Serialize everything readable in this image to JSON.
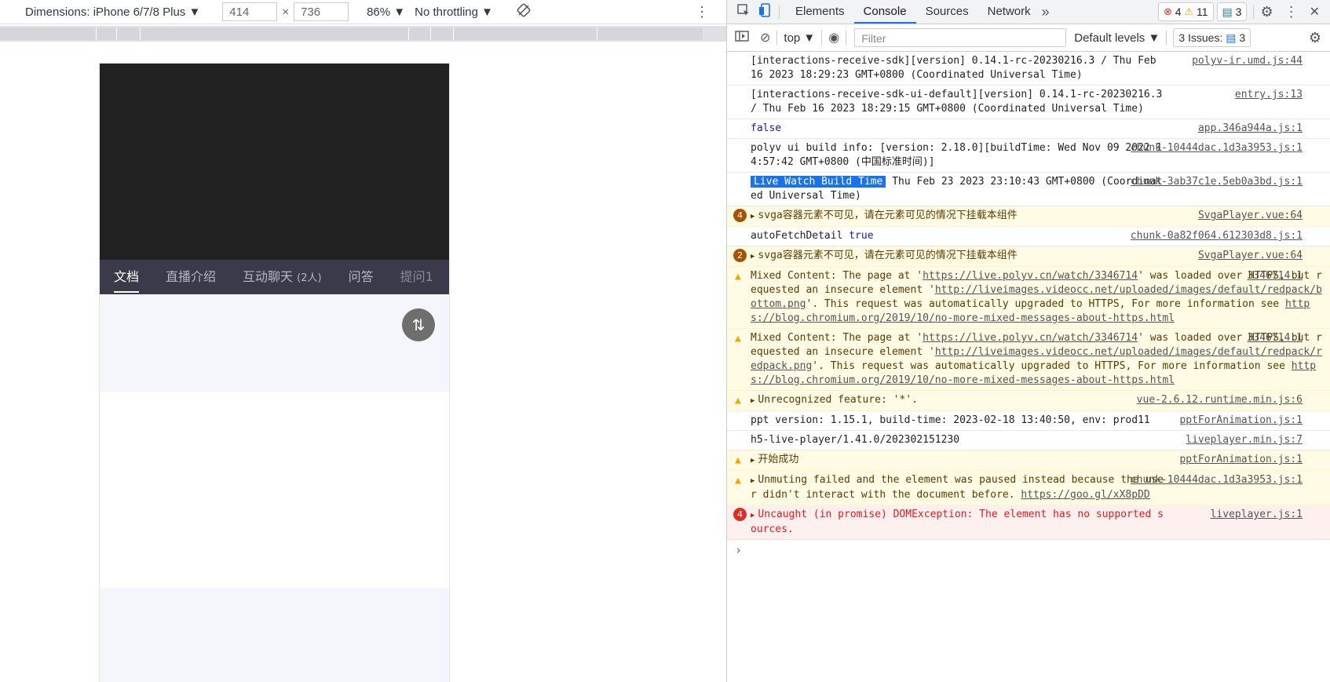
{
  "device_toolbar": {
    "dimensions_label": "Dimensions: iPhone 6/7/8 Plus",
    "width": "414",
    "times": "×",
    "height": "736",
    "zoom": "86%",
    "throttling": "No throttling"
  },
  "mobile": {
    "tabs": [
      {
        "label": "文档",
        "sub": ""
      },
      {
        "label": "直播介绍",
        "sub": ""
      },
      {
        "label": "互动聊天",
        "sub": "(2人)"
      },
      {
        "label": "问答",
        "sub": ""
      },
      {
        "label": "提问1",
        "sub": ""
      }
    ],
    "swap_glyph": "⇅"
  },
  "devtools": {
    "tabs": [
      "Elements",
      "Console",
      "Sources",
      "Network"
    ],
    "more": "»",
    "error_count": "4",
    "warning_count": "11",
    "info_count": "3",
    "filter_context": "top",
    "filter_placeholder": "Filter",
    "levels": "Default levels",
    "issues_label": "3 Issues:",
    "issues_count": "3",
    "prompt": "›"
  },
  "console": [
    {
      "text": "[interactions-receive-sdk][version] 0.14.1-rc-20230216.3 / Thu Feb 16 2023 18:29:23 GMT+0800 (Coordinated Universal Time)",
      "src": "polyv-ir.umd.js:44"
    },
    {
      "text": "[interactions-receive-sdk-ui-default][version] 0.14.1-rc-20230216.3 / Thu Feb 16 2023 18:29:15 GMT+0800 (Coordinated Universal Time)",
      "src": "entry.js:13"
    },
    {
      "text": "false",
      "src": "app.346a944a.js:1"
    },
    {
      "text": "polyv ui build info: [version: 2.18.0][buildTime: Wed Nov 09 2022 14:57:42 GMT+0800 (中国标准时间)]",
      "src": "chunk-10444dac.1d3a3953.js:1"
    },
    {
      "tag": "Live Watch Build Time",
      "text": " Thu Feb 23 2023 23:10:43 GMT+0800 (Coordinated Universal Time)",
      "src": "chunk-3ab37c1e.5eb0a3bd.js:1"
    },
    {
      "count": "4",
      "text": "svga容器元素不可见，请在元素可见的情况下挂载本组件",
      "src": "SvgaPlayer.vue:64"
    },
    {
      "text": "autoFetchDetail",
      "value": "true",
      "src": "chunk-0a82f064.612303d8.js:1"
    },
    {
      "count": "2",
      "text": "svga容器元素不可见，请在元素可见的情况下挂载本组件",
      "src": "SvgaPlayer.vue:64"
    },
    {
      "p1": "Mixed Content: The page at '",
      "l1": "https://live.polyv.cn/watch/3346714",
      "p2": "' was loaded over HTTPS, but requested an insecure element '",
      "l2": "http://liveimages.videocc.net/uploaded/images/default/redpack/bottom.png",
      "p3": "'. This request was automatically upgraded to HTTPS, For more information see ",
      "l3": "https://blog.chromium.org/2019/10/no-more-mixed-messages-about-https.html",
      "src": "3346714:1"
    },
    {
      "p1": "Mixed Content: The page at '",
      "l1": "https://live.polyv.cn/watch/3346714",
      "p2": "' was loaded over HTTPS, but requested an insecure element '",
      "l2": "http://liveimages.videocc.net/uploaded/images/default/redpack/redpack.png",
      "p3": "'. This request was automatically upgraded to HTTPS, For more information see ",
      "l3": "https://blog.chromium.org/2019/10/no-more-mixed-messages-about-https.html",
      "src": "3346714:1"
    },
    {
      "text": "Unrecognized feature: '*'.",
      "src": "vue-2.6.12.runtime.min.js:6"
    },
    {
      "text": "ppt version: 1.15.1, build-time: 2023-02-18 13:40:50, env: prod11",
      "src": "pptForAnimation.js:1"
    },
    {
      "text": "h5-live-player/1.41.0/202302151230",
      "src": "liveplayer.min.js:7"
    },
    {
      "text": "开始成功",
      "src": "pptForAnimation.js:1"
    },
    {
      "text": "Unmuting failed and the element was paused instead because the user didn't interact with the document before. ",
      "link": "https://goo.gl/xX8pDD",
      "src": "chunk-10444dac.1d3a3953.js:1"
    },
    {
      "count": "4",
      "text": "Uncaught (in promise) DOMException: The element has no supported sources.",
      "src": "liveplayer.js:1"
    }
  ]
}
